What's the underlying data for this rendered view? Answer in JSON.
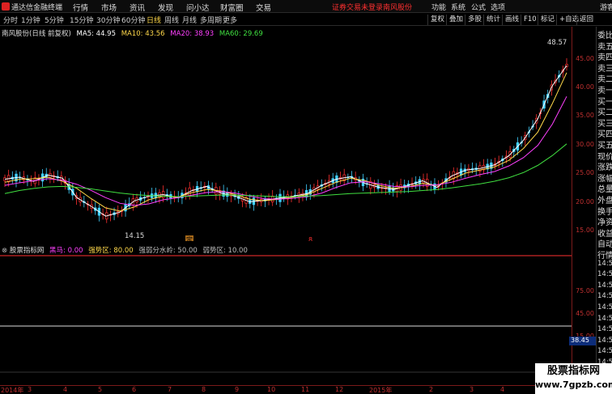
{
  "app": {
    "title": "通达信金融终端"
  },
  "menu": [
    "行情",
    "市场",
    "资讯",
    "发现",
    "问小达",
    "财富圈",
    "交易"
  ],
  "alert": {
    "text": "证券交易未登录",
    "stock": "南风股份"
  },
  "topright": [
    "功能",
    "系统",
    "公式",
    "选项",
    "游客"
  ],
  "periods": [
    "分时",
    "1分钟",
    "5分钟",
    "15分钟",
    "30分钟",
    "60分钟",
    "日线",
    "周线",
    "月线",
    "多周期",
    "更多"
  ],
  "active_period": "日线",
  "tools": [
    "复权",
    "叠加",
    "多股",
    "统计",
    "画线",
    "F10",
    "标记",
    "+自选",
    "返回"
  ],
  "main_legend": {
    "name": "南风股份(日线 前复权)",
    "ma5": "MA5: 44.95",
    "ma10": "MA10: 43.56",
    "ma20": "MA20: 38.93",
    "ma60": "MA60: 29.69"
  },
  "annotations": {
    "high": "48.57",
    "low": "14.15",
    "marker1": "定",
    "marker2": "8"
  },
  "indicator_legend": {
    "name": "股票指标网",
    "hm": "黑马: 0.00",
    "qsq": "强势区: 80.00",
    "fsx": "强弱分水岭: 50.00",
    "rsq": "弱势区: 10.00"
  },
  "y_main": [
    "45.00",
    "40.00",
    "35.00",
    "30.00",
    "25.00",
    "20.00",
    "15.00"
  ],
  "y_ind": [
    "75.00",
    "45.00",
    "15.00"
  ],
  "ind_value": "38.45",
  "rpanel": [
    "委比",
    "卖五",
    "卖四",
    "卖三",
    "卖二",
    "卖一",
    "买一",
    "买二",
    "买三",
    "买四",
    "买五",
    "现价",
    "涨跌",
    "涨幅",
    "总量",
    "外盘",
    "换手",
    "净资",
    "收益",
    "自动",
    "行情",
    "14:50",
    "14:50",
    "14:50",
    "14:50",
    "14:50",
    "14:50",
    "14:50",
    "14:50",
    "14:50",
    "14:50"
  ],
  "dates": [
    "2014年",
    "3",
    "4",
    "5",
    "6",
    "7",
    "8",
    "9",
    "10",
    "11",
    "12",
    "2015年",
    "2",
    "3",
    "4"
  ],
  "watermark": {
    "line1": "股票指标网",
    "line2": "www.7gpzb.com"
  },
  "colors": {
    "ma5": "#ffffff",
    "ma10": "#ffd84a",
    "ma20": "#ff40ff",
    "ma60": "#40e040",
    "up": "#ff3030",
    "down": "#40d0ff"
  },
  "chart_data": {
    "type": "line",
    "title": "南风股份(日线 前复权)",
    "ylim": [
      12,
      50
    ],
    "series": [
      {
        "name": "MA5",
        "values": [
          22.8,
          23.2,
          22.4,
          23.6,
          23.0,
          19.2,
          17.5,
          15.6,
          16.4,
          18.6,
          19.5,
          19.8,
          19.2,
          20.6,
          21.4,
          20.1,
          19.5,
          18.4,
          18.7,
          19.1,
          19.5,
          20.0,
          21.6,
          22.8,
          23.3,
          22.0,
          21.2,
          20.8,
          21.6,
          22.5,
          21.2,
          23.4,
          24.6,
          24.9,
          25.6,
          27.4,
          30.4,
          34.6,
          41.0,
          44.95
        ]
      },
      {
        "name": "MA10",
        "values": [
          22.2,
          22.8,
          22.9,
          23.2,
          22.4,
          21.0,
          19.0,
          17.2,
          16.6,
          17.4,
          18.8,
          19.5,
          19.3,
          20.2,
          20.8,
          20.5,
          19.8,
          18.9,
          18.6,
          18.9,
          19.3,
          19.8,
          21.0,
          22.2,
          23.0,
          22.5,
          21.6,
          21.0,
          21.3,
          22.0,
          21.6,
          22.8,
          24.0,
          24.6,
          25.2,
          26.5,
          28.8,
          32.0,
          37.5,
          43.56
        ]
      },
      {
        "name": "MA20",
        "values": [
          21.6,
          22.1,
          22.5,
          22.9,
          22.6,
          21.8,
          20.6,
          19.2,
          18.1,
          17.7,
          18.0,
          18.8,
          19.2,
          19.7,
          20.2,
          20.4,
          20.1,
          19.5,
          19.0,
          18.9,
          19.1,
          19.4,
          20.1,
          21.2,
          22.1,
          22.3,
          21.9,
          21.4,
          21.3,
          21.6,
          21.7,
          22.2,
          23.0,
          23.7,
          24.3,
          25.4,
          27.0,
          29.4,
          33.5,
          38.93
        ]
      },
      {
        "name": "MA60",
        "values": [
          20.0,
          20.6,
          21.0,
          21.3,
          21.4,
          21.2,
          20.9,
          20.5,
          20.1,
          19.8,
          19.6,
          19.5,
          19.4,
          19.5,
          19.6,
          19.7,
          19.7,
          19.6,
          19.5,
          19.4,
          19.4,
          19.5,
          19.6,
          19.8,
          20.0,
          20.1,
          20.2,
          20.3,
          20.4,
          20.6,
          20.8,
          21.1,
          21.5,
          21.9,
          22.4,
          23.1,
          24.1,
          25.5,
          27.4,
          29.69
        ]
      }
    ]
  }
}
